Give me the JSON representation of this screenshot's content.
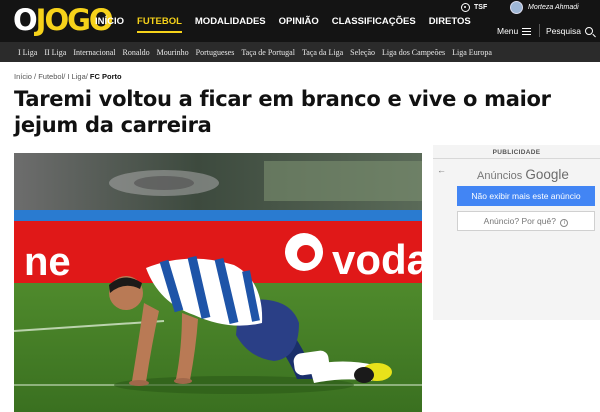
{
  "header": {
    "logo": {
      "o": "O",
      "jogo": "JOGO"
    },
    "nav": [
      "INÍCIO",
      "FUTEBOL",
      "MODALIDADES",
      "OPINIÃO",
      "CLASSIFICAÇÕES",
      "DIRETOS"
    ],
    "active_nav": "FUTEBOL",
    "radio_label": "TSF",
    "user_name": "Morteza Ahmadi",
    "menu_label": "Menu",
    "search_label": "Pesquisa"
  },
  "subnav": [
    "I Liga",
    "II Liga",
    "Internacional",
    "Ronaldo",
    "Mourinho",
    "Portugueses",
    "Taça de Portugal",
    "Taça da Liga",
    "Seleção",
    "Liga dos Campeões",
    "Liga Europa"
  ],
  "breadcrumb": {
    "items": [
      "Início /",
      "Futebol/",
      "I Liga/"
    ],
    "current": "FC Porto"
  },
  "article": {
    "headline": "Taremi voltou a ficar em branco e vive o maior jejum da carreira",
    "photo_banner_text": "vodaf"
  },
  "ad": {
    "publicidade": "PUBLICIDADE",
    "title_prefix": "Anúncios",
    "title_brand": "Google",
    "stop_label": "Não exibir mais este anúncio",
    "why_label": "Anúncio? Por quê?",
    "back_icon": "arrow-left-icon",
    "info_icon": "info-icon"
  },
  "colors": {
    "accent": "#f6d21a",
    "header_bg": "#141414",
    "subnav_bg": "#2b2b2b",
    "ad_blue": "#4285f4"
  }
}
